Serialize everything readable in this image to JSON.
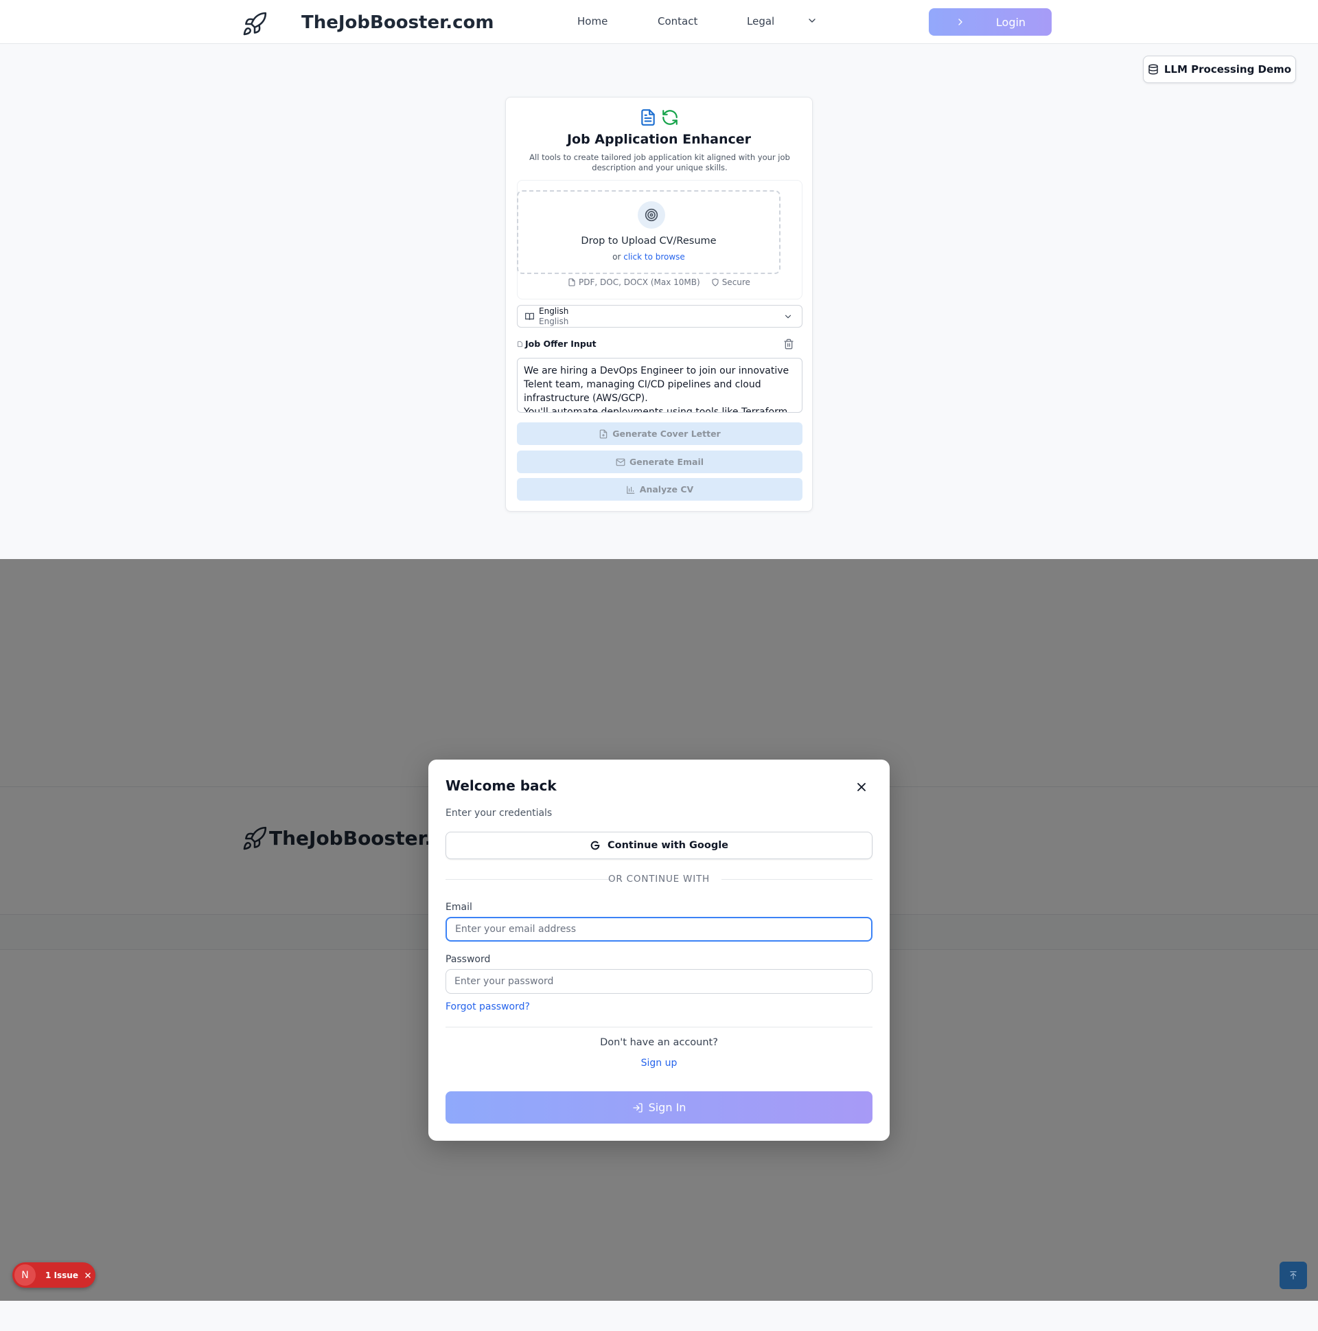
{
  "header": {
    "brand": "TheJobBooster.com",
    "nav": {
      "home": "Home",
      "contact": "Contact",
      "legal": "Legal"
    },
    "login_label": "Login",
    "icons": {
      "logo": "rocket-icon",
      "legal_dropdown": "chevron-down-icon",
      "login": "chevron-right-icon"
    }
  },
  "demo_button": {
    "label": "LLM Processing Demo",
    "icon": "database-icon"
  },
  "enhancer": {
    "title": "Job Application Enhancer",
    "description": "All tools to create tailored job application kit aligned with your job description and your unique skills.",
    "upload": {
      "title": "Drop to Upload CV/Resume",
      "or_text": "or ",
      "browse_link": "click to browse",
      "formats": "PDF, DOC, DOCX (Max 10MB)",
      "secure": "Secure"
    },
    "language": {
      "selected": "English",
      "subtitle": "English"
    },
    "job_offer": {
      "label": "Job Offer Input",
      "text": "We are hiring a DevOps Engineer to join our innovative Telent team, managing CI/CD pipelines and cloud infrastructure (AWS/GCP).\nYou'll automate deployments using tools like Terraform"
    },
    "buttons": {
      "cover_letter": "Generate Cover Letter",
      "email": "Generate Email",
      "analyze": "Analyze CV"
    },
    "colors": {
      "doc_icon": "#1d6fd1",
      "refresh_icon": "#16a34a",
      "button_bg": "#dbeafa"
    }
  },
  "footer": {
    "brand": "TheJobBooster.co"
  },
  "login_modal": {
    "title": "Welcome back",
    "subtitle": "Enter your credentials",
    "google_label": "Continue with Google",
    "divider": "OR CONTINUE WITH",
    "email_label": "Email",
    "email_placeholder": "Enter your email address",
    "password_label": "Password",
    "password_placeholder": "Enter your password",
    "forgot": "Forgot password?",
    "no_account": "Don't have an account?",
    "signup": "Sign up",
    "signin": "Sign In",
    "colors": {
      "link": "#2563eb",
      "gradient_start": "#8fa9fb",
      "gradient_end": "#a79af6"
    }
  },
  "issue_badge": {
    "letter": "N",
    "label": "1 Issue"
  }
}
